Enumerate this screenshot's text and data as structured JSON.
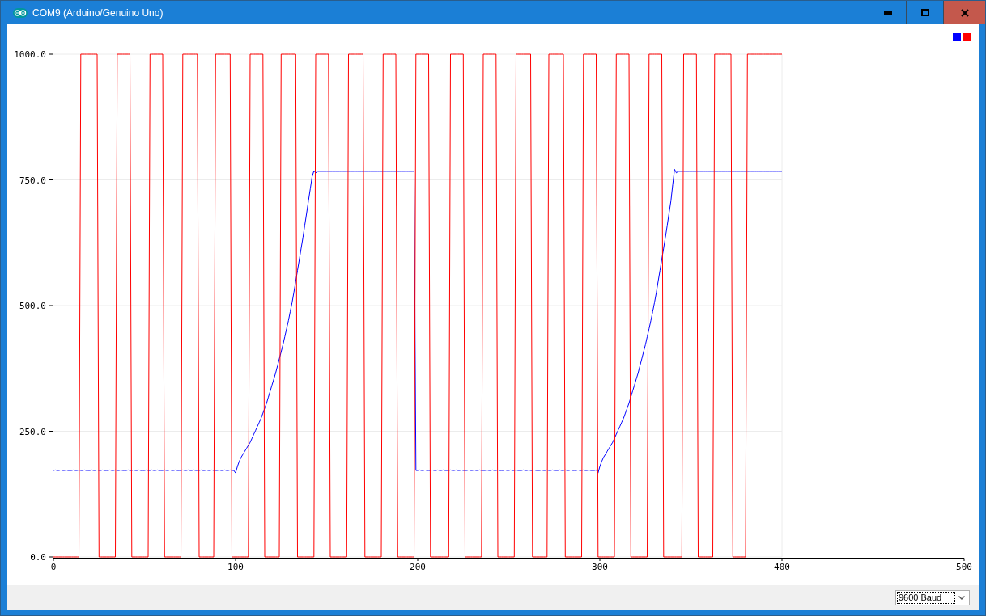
{
  "window": {
    "title": "COM9 (Arduino/Genuino Uno)"
  },
  "plot": {
    "chart_data": {
      "type": "line",
      "grid": true,
      "xlim": [
        0,
        500
      ],
      "ylim": [
        0,
        1000
      ],
      "xticks": [
        0,
        100,
        200,
        300,
        400,
        500
      ],
      "yticks": [
        {
          "value": 0,
          "label": "0.0"
        },
        {
          "value": 250,
          "label": "250.0"
        },
        {
          "value": 500,
          "label": "500.0"
        },
        {
          "value": 750,
          "label": "750.0"
        },
        {
          "value": 1000,
          "label": "1000.0"
        }
      ],
      "x": [
        0,
        1,
        2,
        3,
        4,
        5,
        6,
        7,
        8,
        9,
        10,
        11,
        12,
        13,
        14,
        15,
        16,
        17,
        18,
        19,
        20,
        21,
        22,
        23,
        24,
        25,
        26,
        27,
        28,
        29,
        30,
        31,
        32,
        33,
        34,
        35,
        36,
        37,
        38,
        39,
        40,
        41,
        42,
        43,
        44,
        45,
        46,
        47,
        48,
        49,
        50,
        51,
        52,
        53,
        54,
        55,
        56,
        57,
        58,
        59,
        60,
        61,
        62,
        63,
        64,
        65,
        66,
        67,
        68,
        69,
        70,
        71,
        72,
        73,
        74,
        75,
        76,
        77,
        78,
        79,
        80,
        81,
        82,
        83,
        84,
        85,
        86,
        87,
        88,
        89,
        90,
        91,
        92,
        93,
        94,
        95,
        96,
        97,
        98,
        99,
        100,
        101,
        102,
        103,
        104,
        105,
        106,
        107,
        108,
        109,
        110,
        111,
        112,
        113,
        114,
        115,
        116,
        117,
        118,
        119,
        120,
        121,
        122,
        123,
        124,
        125,
        126,
        127,
        128,
        129,
        130,
        131,
        132,
        133,
        134,
        135,
        136,
        137,
        138,
        139,
        140,
        141,
        142,
        143,
        144,
        145,
        146,
        147,
        148,
        149,
        150,
        151,
        152,
        153,
        154,
        155,
        156,
        157,
        158,
        159,
        160,
        161,
        162,
        163,
        164,
        165,
        166,
        167,
        168,
        169,
        170,
        171,
        172,
        173,
        174,
        175,
        176,
        177,
        178,
        179,
        180,
        181,
        182,
        183,
        184,
        185,
        186,
        187,
        188,
        189,
        190,
        191,
        192,
        193,
        194,
        195,
        196,
        197,
        198,
        199,
        200,
        201,
        202,
        203,
        204,
        205,
        206,
        207,
        208,
        209,
        210,
        211,
        212,
        213,
        214,
        215,
        216,
        217,
        218,
        219,
        220,
        221,
        222,
        223,
        224,
        225,
        226,
        227,
        228,
        229,
        230,
        231,
        232,
        233,
        234,
        235,
        236,
        237,
        238,
        239,
        240,
        241,
        242,
        243,
        244,
        245,
        246,
        247,
        248,
        249,
        250,
        251,
        252,
        253,
        254,
        255,
        256,
        257,
        258,
        259,
        260,
        261,
        262,
        263,
        264,
        265,
        266,
        267,
        268,
        269,
        270,
        271,
        272,
        273,
        274,
        275,
        276,
        277,
        278,
        279,
        280,
        281,
        282,
        283,
        284,
        285,
        286,
        287,
        288,
        289,
        290,
        291,
        292,
        293,
        294,
        295,
        296,
        297,
        298,
        299,
        300,
        301,
        302,
        303,
        304,
        305,
        306,
        307,
        308,
        309,
        310,
        311,
        312,
        313,
        314,
        315,
        316,
        317,
        318,
        319,
        320,
        321,
        322,
        323,
        324,
        325,
        326,
        327,
        328,
        329,
        330,
        331,
        332,
        333,
        334,
        335,
        336,
        337,
        338,
        339,
        340,
        341,
        342,
        343,
        344,
        345,
        346,
        347,
        348,
        349,
        350,
        351,
        352,
        353,
        354,
        355,
        356,
        357,
        358,
        359,
        360,
        361,
        362,
        363,
        364,
        365,
        366,
        367,
        368,
        369,
        370,
        371,
        372,
        373,
        374,
        375,
        376,
        377,
        378,
        379,
        380,
        381,
        382,
        383,
        384,
        385,
        386,
        387,
        388,
        389,
        390,
        391,
        392,
        393,
        394,
        395,
        396,
        397,
        398,
        399,
        400
      ],
      "series": [
        {
          "color": "#0000ff",
          "values": [
            172,
            173,
            172,
            172,
            173,
            172,
            172,
            173,
            172,
            172,
            172,
            173,
            172,
            172,
            173,
            172,
            172,
            173,
            172,
            172,
            172,
            173,
            172,
            172,
            173,
            172,
            172,
            173,
            172,
            172,
            172,
            173,
            172,
            172,
            173,
            172,
            172,
            173,
            172,
            172,
            172,
            173,
            172,
            172,
            173,
            172,
            172,
            173,
            172,
            172,
            172,
            173,
            172,
            172,
            173,
            172,
            172,
            173,
            172,
            172,
            172,
            173,
            172,
            172,
            173,
            172,
            172,
            173,
            172,
            172,
            172,
            173,
            172,
            172,
            173,
            172,
            172,
            173,
            172,
            172,
            172,
            173,
            172,
            172,
            173,
            172,
            172,
            173,
            172,
            172,
            172,
            173,
            172,
            172,
            173,
            172,
            172,
            173,
            172,
            172,
            167,
            180,
            190,
            198,
            204,
            210,
            216,
            222,
            228,
            236,
            244,
            252,
            260,
            268,
            276,
            286,
            296,
            306,
            318,
            330,
            342,
            354,
            366,
            380,
            394,
            408,
            422,
            438,
            454,
            470,
            488,
            506,
            526,
            548,
            570,
            592,
            614,
            636,
            660,
            684,
            708,
            732,
            756,
            768,
            764,
            767,
            767,
            767,
            767,
            767,
            767,
            767,
            767,
            767,
            767,
            767,
            767,
            767,
            767,
            767,
            767,
            767,
            767,
            767,
            767,
            767,
            767,
            767,
            767,
            767,
            767,
            767,
            767,
            767,
            767,
            767,
            767,
            767,
            767,
            767,
            767,
            767,
            767,
            767,
            767,
            767,
            767,
            767,
            767,
            767,
            767,
            767,
            767,
            767,
            767,
            767,
            767,
            767,
            767,
            172,
            172,
            173,
            172,
            172,
            173,
            172,
            172,
            172,
            173,
            172,
            172,
            173,
            172,
            172,
            173,
            172,
            172,
            172,
            173,
            172,
            172,
            173,
            172,
            172,
            173,
            172,
            172,
            172,
            173,
            172,
            172,
            173,
            172,
            172,
            173,
            172,
            172,
            172,
            173,
            172,
            172,
            173,
            172,
            172,
            173,
            172,
            172,
            172,
            173,
            172,
            172,
            173,
            172,
            172,
            173,
            172,
            172,
            172,
            173,
            172,
            172,
            173,
            172,
            172,
            173,
            172,
            172,
            172,
            173,
            172,
            172,
            173,
            172,
            172,
            173,
            172,
            172,
            172,
            173,
            172,
            172,
            173,
            172,
            172,
            173,
            172,
            172,
            172,
            173,
            172,
            172,
            173,
            172,
            172,
            173,
            172,
            172,
            172,
            173,
            167,
            180,
            190,
            198,
            204,
            210,
            216,
            222,
            228,
            236,
            244,
            252,
            260,
            268,
            276,
            286,
            296,
            306,
            318,
            330,
            342,
            354,
            366,
            380,
            394,
            408,
            422,
            438,
            454,
            470,
            488,
            506,
            526,
            548,
            570,
            592,
            614,
            636,
            660,
            684,
            708,
            740,
            771,
            764,
            767,
            767,
            767,
            767,
            767,
            767,
            767,
            767,
            767,
            767,
            767,
            767,
            767,
            767,
            767,
            767,
            767,
            767,
            767,
            767,
            767,
            767,
            767,
            767,
            767,
            767,
            767,
            767,
            767,
            767,
            767,
            767,
            767,
            767,
            767,
            767,
            767,
            767,
            767,
            767,
            767,
            767,
            767,
            767,
            767,
            767,
            767,
            767,
            767,
            767,
            767,
            767,
            767,
            767,
            767,
            767,
            767,
            767
          ]
        },
        {
          "color": "#ff0000",
          "values": [
            0,
            0,
            0,
            0,
            0,
            0,
            0,
            0,
            0,
            0,
            0,
            0,
            0,
            0,
            0,
            1000,
            1000,
            1000,
            1000,
            1000,
            1000,
            1000,
            1000,
            1000,
            1000,
            0,
            0,
            0,
            0,
            0,
            0,
            0,
            0,
            0,
            0,
            1000,
            1000,
            1000,
            1000,
            1000,
            1000,
            1000,
            1000,
            0,
            0,
            0,
            0,
            0,
            0,
            0,
            0,
            0,
            0,
            1000,
            1000,
            1000,
            1000,
            1000,
            1000,
            1000,
            1000,
            0,
            0,
            0,
            0,
            0,
            0,
            0,
            0,
            0,
            0,
            1000,
            1000,
            1000,
            1000,
            1000,
            1000,
            1000,
            1000,
            1000,
            0,
            0,
            0,
            0,
            0,
            0,
            0,
            0,
            0,
            1000,
            1000,
            1000,
            1000,
            1000,
            1000,
            1000,
            1000,
            1000,
            0,
            0,
            0,
            0,
            0,
            0,
            0,
            0,
            0,
            0,
            1000,
            1000,
            1000,
            1000,
            1000,
            1000,
            1000,
            1000,
            0,
            0,
            0,
            0,
            0,
            0,
            0,
            0,
            0,
            1000,
            1000,
            1000,
            1000,
            1000,
            1000,
            1000,
            1000,
            1000,
            0,
            0,
            0,
            0,
            0,
            0,
            0,
            0,
            0,
            0,
            1000,
            1000,
            1000,
            1000,
            1000,
            1000,
            1000,
            1000,
            0,
            0,
            0,
            0,
            0,
            0,
            0,
            0,
            0,
            0,
            1000,
            1000,
            1000,
            1000,
            1000,
            1000,
            1000,
            1000,
            1000,
            0,
            0,
            0,
            0,
            0,
            0,
            0,
            0,
            0,
            0,
            1000,
            1000,
            1000,
            1000,
            1000,
            1000,
            1000,
            1000,
            0,
            0,
            0,
            0,
            0,
            0,
            0,
            0,
            0,
            0,
            1000,
            1000,
            1000,
            1000,
            1000,
            1000,
            1000,
            1000,
            0,
            0,
            0,
            0,
            0,
            0,
            0,
            0,
            0,
            0,
            0,
            1000,
            1000,
            1000,
            1000,
            1000,
            1000,
            1000,
            1000,
            0,
            0,
            0,
            0,
            0,
            0,
            0,
            0,
            0,
            0,
            1000,
            1000,
            1000,
            1000,
            1000,
            1000,
            1000,
            1000,
            0,
            0,
            0,
            0,
            0,
            0,
            0,
            0,
            0,
            0,
            1000,
            1000,
            1000,
            1000,
            1000,
            1000,
            1000,
            1000,
            1000,
            0,
            0,
            0,
            0,
            0,
            0,
            0,
            0,
            0,
            1000,
            1000,
            1000,
            1000,
            1000,
            1000,
            1000,
            1000,
            1000,
            0,
            0,
            0,
            0,
            0,
            0,
            0,
            0,
            0,
            0,
            1000,
            1000,
            1000,
            1000,
            1000,
            1000,
            1000,
            1000,
            0,
            0,
            0,
            0,
            0,
            0,
            0,
            0,
            0,
            0,
            1000,
            1000,
            1000,
            1000,
            1000,
            1000,
            1000,
            1000,
            0,
            0,
            0,
            0,
            0,
            0,
            0,
            0,
            0,
            0,
            1000,
            1000,
            1000,
            1000,
            1000,
            1000,
            1000,
            1000,
            0,
            0,
            0,
            0,
            0,
            0,
            0,
            0,
            0,
            0,
            0,
            1000,
            1000,
            1000,
            1000,
            1000,
            1000,
            1000,
            1000,
            0,
            0,
            0,
            0,
            0,
            0,
            0,
            0,
            0,
            1000,
            1000,
            1000,
            1000,
            1000,
            1000,
            1000,
            1000,
            1000,
            1000,
            0,
            0,
            0,
            0,
            0,
            0,
            0,
            0,
            1000,
            1000,
            1000,
            1000,
            1000,
            1000,
            1000,
            1000,
            1000,
            1000,
            1000,
            1000,
            1000,
            1000,
            1000,
            1000,
            1000,
            1000,
            1000,
            1000
          ]
        }
      ]
    }
  },
  "status_bar": {
    "baud_select": {
      "value": "9600 Baud"
    }
  }
}
